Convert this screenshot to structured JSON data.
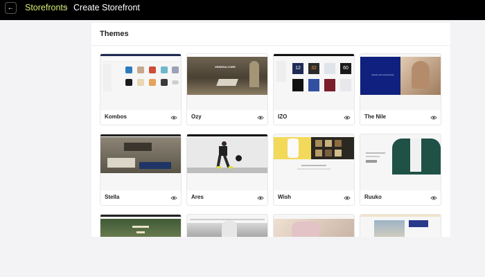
{
  "header": {
    "back_icon_glyph": "←",
    "breadcrumb_parent": "Storefronts",
    "breadcrumb_separator": "›",
    "breadcrumb_current": "Create Storefront"
  },
  "panel": {
    "title": "Themes"
  },
  "themes": [
    {
      "name": "Kombos"
    },
    {
      "name": "Ozy"
    },
    {
      "name": "IZO"
    },
    {
      "name": "The Nile"
    },
    {
      "name": "Stella"
    },
    {
      "name": "Ares"
    },
    {
      "name": "Wish"
    },
    {
      "name": "Ruuko"
    }
  ],
  "thumb_text": {
    "ozy_banner": "VENEZIA CORE",
    "nile_text": "Jewelry and accessories",
    "izo_numbers": [
      "12",
      "32",
      "",
      "60"
    ]
  },
  "colors": {
    "accent": "#d6ef75",
    "topbar": "#000000",
    "nile_blue": "#10207e",
    "ruuko_green": "#1f5147"
  }
}
